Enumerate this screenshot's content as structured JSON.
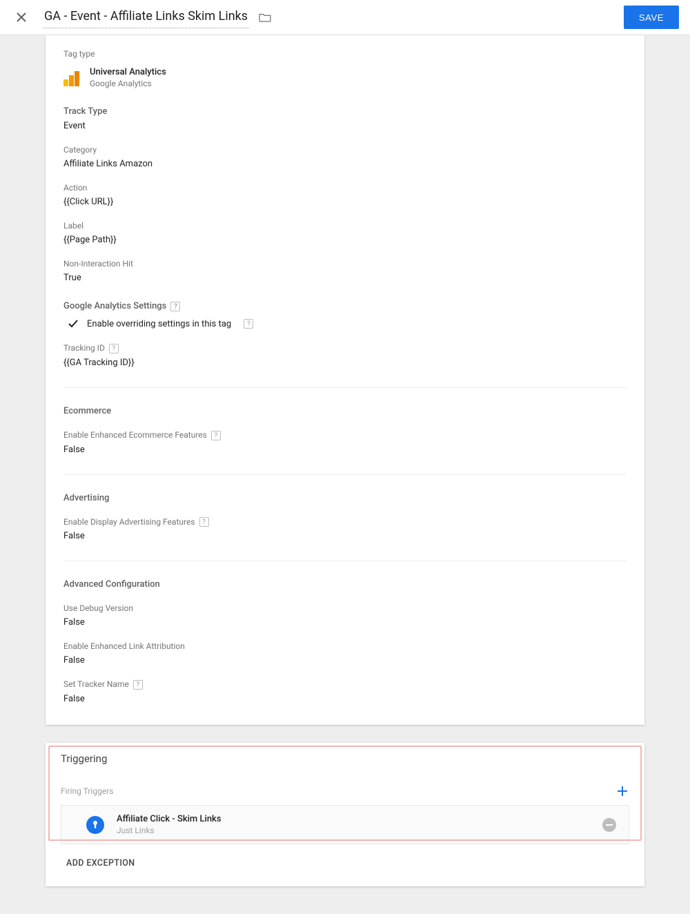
{
  "header": {
    "title": "GA - Event - Affiliate Links Skim Links",
    "save_label": "SAVE"
  },
  "tag_type": {
    "label": "Tag type",
    "name": "Universal Analytics",
    "vendor": "Google Analytics"
  },
  "fields": {
    "track_type": {
      "label": "Track Type",
      "value": "Event"
    },
    "category": {
      "label": "Category",
      "value": "Affiliate Links Amazon"
    },
    "action": {
      "label": "Action",
      "value": "{{Click URL}}"
    },
    "label_f": {
      "label": "Label",
      "value": "{{Page Path}}"
    },
    "non_interaction": {
      "label": "Non-Interaction Hit",
      "value": "True"
    },
    "ga_settings": {
      "label": "Google Analytics Settings",
      "override": "Enable overriding settings in this tag"
    },
    "tracking_id": {
      "label": "Tracking ID",
      "value": "{{GA Tracking ID}}"
    }
  },
  "ecommerce": {
    "title": "Ecommerce",
    "enhanced": {
      "label": "Enable Enhanced Ecommerce Features",
      "value": "False"
    }
  },
  "advertising": {
    "title": "Advertising",
    "display": {
      "label": "Enable Display Advertising Features",
      "value": "False"
    }
  },
  "advanced": {
    "title": "Advanced Configuration",
    "debug": {
      "label": "Use Debug Version",
      "value": "False"
    },
    "elink": {
      "label": "Enable Enhanced Link Attribution",
      "value": "False"
    },
    "tracker": {
      "label": "Set Tracker Name",
      "value": "False"
    }
  },
  "triggering": {
    "title": "Triggering",
    "firing_label": "Firing Triggers",
    "trigger": {
      "name": "Affiliate Click - Skim Links",
      "type": "Just Links"
    },
    "add_exception": "ADD EXCEPTION"
  }
}
